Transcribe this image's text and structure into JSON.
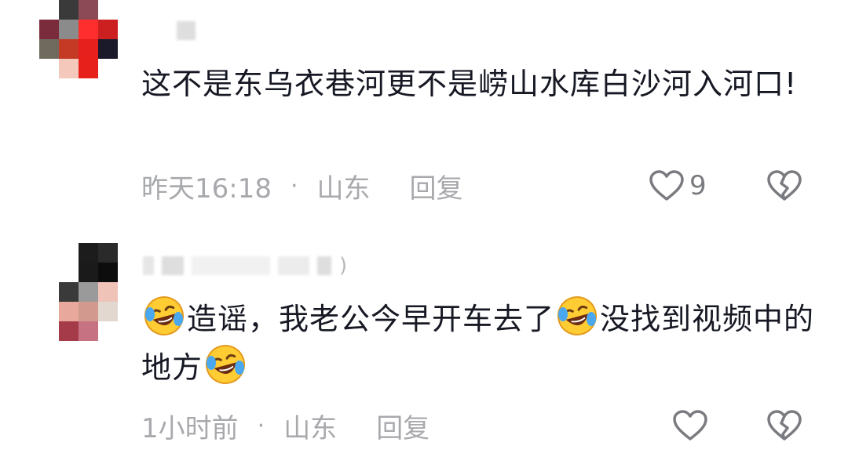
{
  "comments": [
    {
      "username": "",
      "text": "这不是东乌衣巷河更不是崂山水库白沙河入河口!",
      "time": "昨天16:18",
      "separator": "·",
      "location": "山东",
      "reply_label": "回复",
      "like_count": "9",
      "avatar_colors": [
        "#ffffff",
        "#3a3a3a",
        "#8b4a55",
        "#ffffff",
        "#7b2c3c",
        "#8b8b8b",
        "#ff2e2e",
        "#cc2020",
        "#706a5e",
        "#c43a24",
        "#e6201c",
        "#1a1a2a",
        "#ffffff",
        "#f4c9bb",
        "#e8201c",
        "#ffffff"
      ]
    },
    {
      "username_suffix": ")",
      "text_parts": [
        "造谣，我老公今早开车去了",
        "没找到视频中的地方"
      ],
      "time": "1小时前",
      "separator": "·",
      "location": "山东",
      "reply_label": "回复",
      "like_count": "",
      "avatar_colors": [
        "#ffffff",
        "#1c1c1c",
        "#2a2a2a",
        "#ffffff",
        "#1a1a1a",
        "#0d0d0d",
        "#3a3a3a",
        "#9a9a9a",
        "#f0c3b8",
        "#e8a89c",
        "#d29a8f",
        "#e2d8d0",
        "#a53a48",
        "#c67282",
        "#ffffff",
        "#ffffff"
      ]
    }
  ],
  "icons": {
    "like": "heart-outline-icon",
    "dislike": "broken-heart-icon",
    "emoji": "crying-laughing-emoji"
  },
  "colors": {
    "meta": "#a8a9ad",
    "text": "#161823",
    "icon_stroke": "#7a7b80"
  }
}
